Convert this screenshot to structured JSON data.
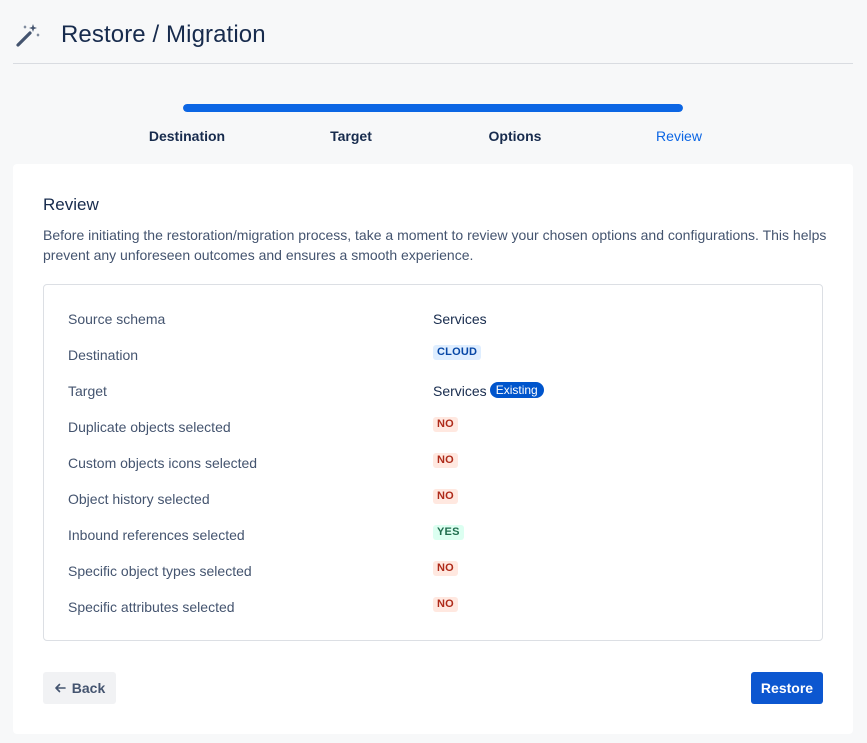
{
  "header": {
    "title": "Restore / Migration",
    "icon": "magic-wand-icon"
  },
  "progress": {
    "fraction": 1.0,
    "color": "#0c66e4",
    "steps": [
      "Destination",
      "Target",
      "Options",
      "Review"
    ],
    "active_step": "Review"
  },
  "review": {
    "heading": "Review",
    "description": "Before initiating the restoration/migration process, take a moment to review your chosen options and configurations. This helps prevent any unforeseen outcomes and ensures a smooth experience.",
    "rows": [
      {
        "label": "Source schema",
        "value": "Services"
      },
      {
        "label": "Destination",
        "badge": "CLOUD"
      },
      {
        "label": "Target",
        "value": "Services",
        "tag": "Existing"
      },
      {
        "label": "Duplicate objects selected",
        "badge": "NO"
      },
      {
        "label": "Custom objects icons selected",
        "badge": "NO"
      },
      {
        "label": "Object history selected",
        "badge": "NO"
      },
      {
        "label": "Inbound references selected",
        "badge": "YES"
      },
      {
        "label": "Specific object types selected",
        "badge": "NO"
      },
      {
        "label": "Specific attributes selected",
        "badge": "NO"
      }
    ]
  },
  "actions": {
    "back_label": "Back",
    "back_icon": "arrow-left-icon",
    "restore_label": "Restore"
  }
}
